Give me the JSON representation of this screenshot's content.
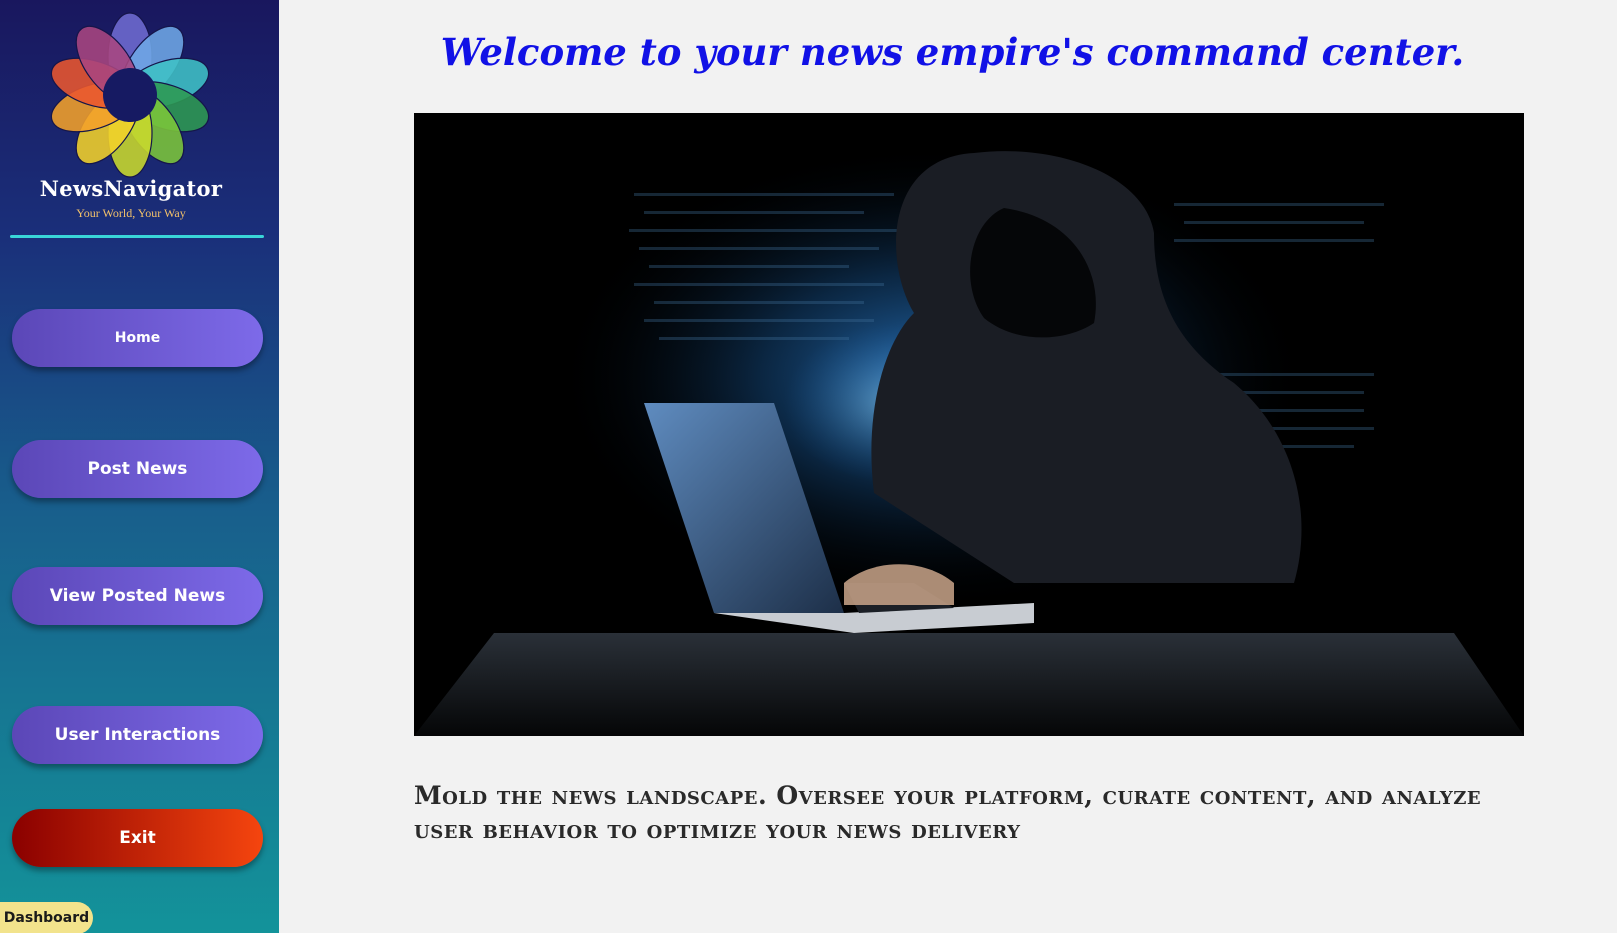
{
  "sidebar": {
    "brand": {
      "name": "NewsNavigator",
      "tagline": "Your World, Your Way"
    },
    "nav": {
      "home": "Home",
      "post_news": "Post News",
      "view_posted_news": "View Posted News",
      "user_interactions": "User Interactions",
      "exit": "Exit"
    },
    "badge": "Dashboard"
  },
  "main": {
    "welcome": "Welcome to your news empire's command center.",
    "hero_image": "hooded-figure-typing-on-laptop",
    "tagline": "Mold the news landscape. Oversee your platform, curate content, and analyze user behavior to optimize your news delivery"
  },
  "colors": {
    "accent_purple": "#7d6ae9",
    "exit_red": "#f5450e",
    "welcome_blue": "#1111e6",
    "divider_cyan": "#39d6d8",
    "badge_yellow": "#f2e38c"
  }
}
